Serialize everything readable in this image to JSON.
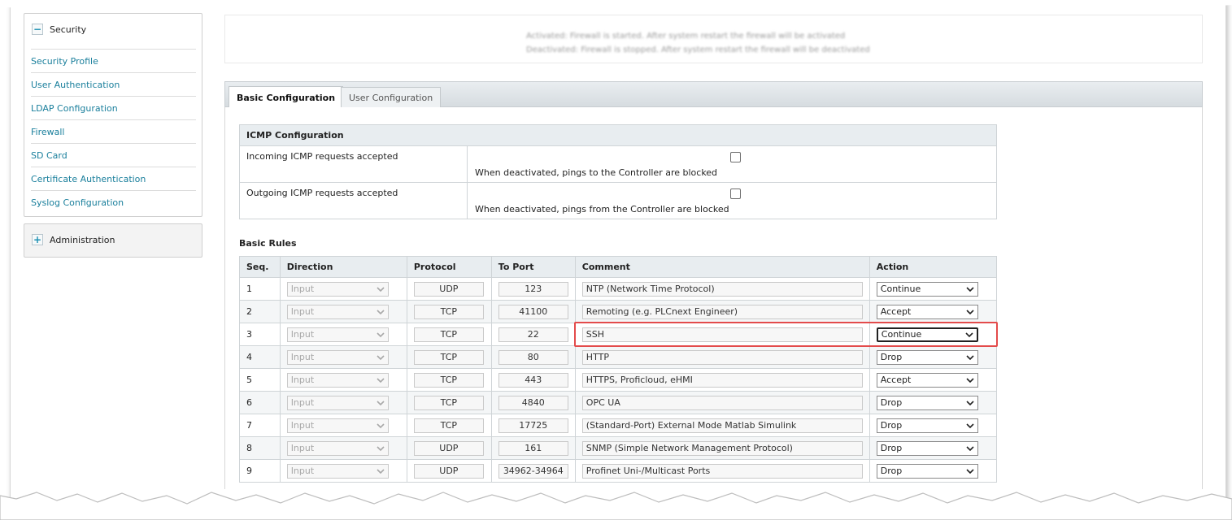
{
  "sidebar": {
    "security": {
      "title": "Security",
      "toggle": "−",
      "items": [
        {
          "label": "Security Profile"
        },
        {
          "label": "User Authentication"
        },
        {
          "label": "LDAP Configuration"
        },
        {
          "label": "Firewall"
        },
        {
          "label": "SD Card"
        },
        {
          "label": "Certificate Authentication"
        },
        {
          "label": "Syslog Configuration"
        }
      ]
    },
    "administration": {
      "title": "Administration",
      "toggle": "+"
    }
  },
  "info": {
    "line1": "Activated: Firewall is started. After system restart the firewall will be activated",
    "line2": "Deactivated: Firewall is stopped. After system restart the firewall will be deactivated"
  },
  "tabs": [
    {
      "label": "Basic Configuration",
      "active": true
    },
    {
      "label": "User Configuration",
      "active": false
    }
  ],
  "icmp": {
    "header": "ICMP Configuration",
    "rows": [
      {
        "label": "Incoming ICMP requests accepted",
        "hint": "When deactivated, pings to the Controller are blocked",
        "checked": false
      },
      {
        "label": "Outgoing ICMP requests accepted",
        "hint": "When deactivated, pings from the Controller are blocked",
        "checked": false
      }
    ]
  },
  "basic_rules": {
    "title": "Basic Rules",
    "columns": {
      "seq": "Seq.",
      "direction": "Direction",
      "protocol": "Protocol",
      "to_port": "To Port",
      "comment": "Comment",
      "action": "Action"
    },
    "rows": [
      {
        "seq": "1",
        "direction": "Input",
        "protocol": "UDP",
        "port": "123",
        "comment": "NTP (Network Time Protocol)",
        "action": "Continue"
      },
      {
        "seq": "2",
        "direction": "Input",
        "protocol": "TCP",
        "port": "41100",
        "comment": "Remoting (e.g. PLCnext Engineer)",
        "action": "Accept"
      },
      {
        "seq": "3",
        "direction": "Input",
        "protocol": "TCP",
        "port": "22",
        "comment": "SSH",
        "action": "Continue"
      },
      {
        "seq": "4",
        "direction": "Input",
        "protocol": "TCP",
        "port": "80",
        "comment": "HTTP",
        "action": "Drop"
      },
      {
        "seq": "5",
        "direction": "Input",
        "protocol": "TCP",
        "port": "443",
        "comment": "HTTPS, Proficloud, eHMI",
        "action": "Accept"
      },
      {
        "seq": "6",
        "direction": "Input",
        "protocol": "TCP",
        "port": "4840",
        "comment": "OPC UA",
        "action": "Drop"
      },
      {
        "seq": "7",
        "direction": "Input",
        "protocol": "TCP",
        "port": "17725",
        "comment": "(Standard-Port) External Mode Matlab Simulink",
        "action": "Drop"
      },
      {
        "seq": "8",
        "direction": "Input",
        "protocol": "UDP",
        "port": "161",
        "comment": "SNMP (Simple Network Management Protocol)",
        "action": "Drop"
      },
      {
        "seq": "9",
        "direction": "Input",
        "protocol": "UDP",
        "port": "34962-34964",
        "comment": "Profinet Uni-/Multicast Ports",
        "action": "Drop"
      }
    ]
  },
  "colors": {
    "link": "#1a7f9c",
    "header_bg": "#e8edf0",
    "highlight": "#e34b4b"
  }
}
